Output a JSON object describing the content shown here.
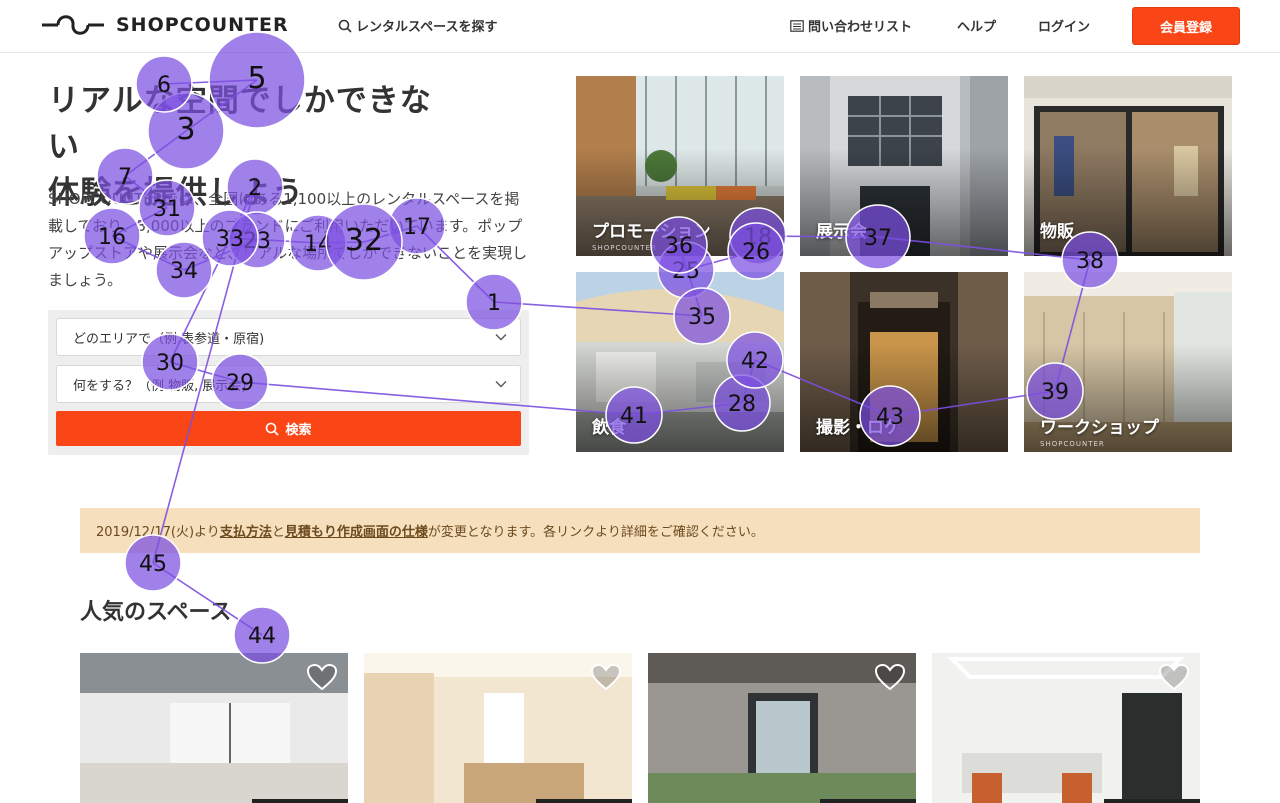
{
  "header": {
    "logo_text": "SHOPCOUNTER",
    "search_link": "レンタルスペースを探す",
    "inquiry_list": "問い合わせリスト",
    "help": "ヘルプ",
    "login": "ログイン",
    "register": "会員登録"
  },
  "hero": {
    "title_line1": "リアルな空間でしかできない",
    "title_line2": "体験を提供しよう",
    "description": "SHOPCOUNTERでは、全国にある1,100以上のレンタルスペースを掲載しており、3,000以上のブランドにご利用いただいています。ポップアップストアや展示会など、リアルな場所でしかできないことを実現しましょう。"
  },
  "search": {
    "area_placeholder": "どのエリアで（例.表参道・原宿)",
    "purpose_placeholder": "何をする？（例.物販, 展示会)",
    "button": "検索"
  },
  "categories": [
    {
      "label": "プロモーション",
      "brand": "SHOPCOUNTER"
    },
    {
      "label": "展示会",
      "brand": ""
    },
    {
      "label": "物販",
      "brand": ""
    },
    {
      "label": "飲食",
      "brand": ""
    },
    {
      "label": "撮影・ロケ",
      "brand": ""
    },
    {
      "label": "ワークショップ",
      "brand": "SHOPCOUNTER"
    }
  ],
  "notice": {
    "prefix": "2019/12/17(火)より",
    "link1": "支払方法",
    "mid": "と",
    "link2": "見積もり作成画面の仕様",
    "suffix": "が変更となります。各リンクより詳細をご確認ください。"
  },
  "popular": {
    "title": "人気のスペース"
  },
  "colors": {
    "accent": "#fa4616",
    "gaze_fill": "#7b4fe0",
    "notice_bg": "#f5dfbd"
  },
  "gaze_points": [
    {
      "n": "1"
    },
    {
      "n": "2"
    },
    {
      "n": "3"
    },
    {
      "n": "5"
    },
    {
      "n": "6"
    },
    {
      "n": "7"
    },
    {
      "n": "14"
    },
    {
      "n": "16"
    },
    {
      "n": "17"
    },
    {
      "n": "18"
    },
    {
      "n": "23"
    },
    {
      "n": "25"
    },
    {
      "n": "26"
    },
    {
      "n": "28"
    },
    {
      "n": "29"
    },
    {
      "n": "30"
    },
    {
      "n": "31"
    },
    {
      "n": "32"
    },
    {
      "n": "33"
    },
    {
      "n": "34"
    },
    {
      "n": "35"
    },
    {
      "n": "36"
    },
    {
      "n": "37"
    },
    {
      "n": "38"
    },
    {
      "n": "39"
    },
    {
      "n": "41"
    },
    {
      "n": "42"
    },
    {
      "n": "43"
    },
    {
      "n": "44"
    },
    {
      "n": "45"
    }
  ]
}
